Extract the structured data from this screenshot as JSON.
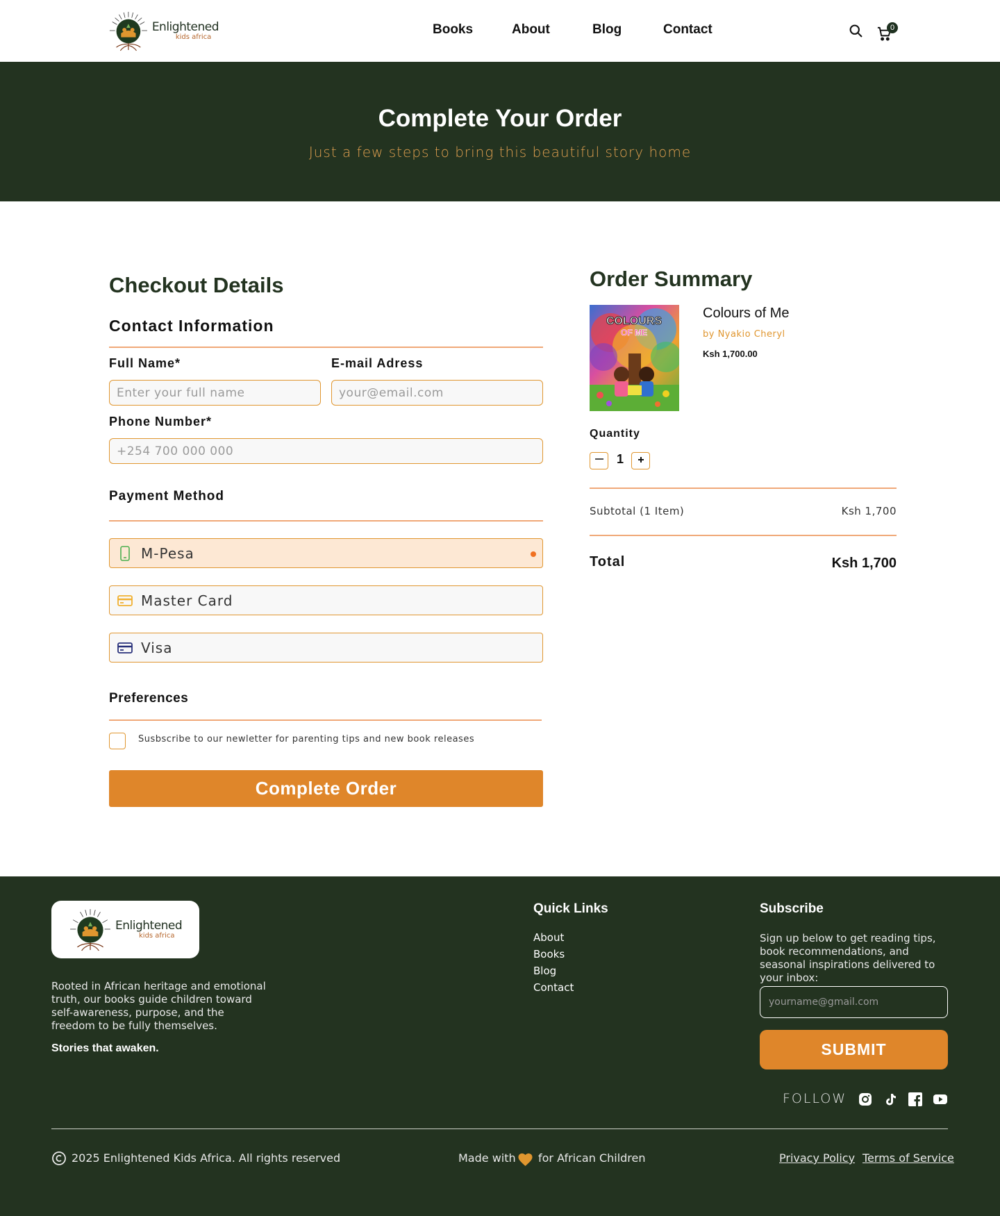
{
  "header": {
    "logo": {
      "line1": "Enlightened",
      "line2": "kids africa"
    },
    "nav": [
      "Books",
      "About",
      "Blog",
      "Contact"
    ],
    "cart_count": "0"
  },
  "hero": {
    "title": "Complete Your Order",
    "subtitle": "Just a few steps to bring this beautiful story home"
  },
  "checkout": {
    "title": "Checkout Details",
    "contact_heading": "Contact Information",
    "full_name_label": "Full Name*",
    "full_name_placeholder": "Enter your full name",
    "email_label": "E-mail Adress",
    "email_placeholder": "your@email.com",
    "phone_label": "Phone Number*",
    "phone_placeholder": "+254 700 000 000",
    "payment_heading": "Payment Method",
    "payment_options": [
      {
        "label": "M-Pesa",
        "icon": "phone-icon",
        "selected": true
      },
      {
        "label": "Master Card",
        "icon": "credit-card-icon",
        "selected": false
      },
      {
        "label": "Visa",
        "icon": "credit-card-icon",
        "selected": false
      }
    ],
    "preferences_heading": "Preferences",
    "newsletter_label": "Susbscribe to our newletter for parenting tips and new book releases",
    "submit_label": "Complete Order"
  },
  "summary": {
    "title": "Order Summary",
    "product": {
      "title": "Colours of Me",
      "author": "by Nyakio Cheryl",
      "price": "Ksh 1,700.00",
      "cover_text": "COLOURS OF ME"
    },
    "quantity_label": "Quantity",
    "quantity": "1",
    "subtotal_label": "Subtotal (1 Item)",
    "subtotal_value": "Ksh 1,700",
    "total_label": "Total",
    "total_value": "Ksh 1,700"
  },
  "footer": {
    "about": "Rooted in African heritage and emotional truth, our books guide children toward self-awareness, purpose, and the freedom to be fully themselves.",
    "tagline": "Stories that awaken.",
    "quick_links_heading": "Quick Links",
    "quick_links": [
      "About",
      "Books",
      "Blog",
      "Contact"
    ],
    "subscribe_heading": "Subscribe",
    "subscribe_text": "Sign up below to get reading tips, book recommendations, and seasonal inspirations delivered to your inbox:",
    "email_placeholder": "yourname@gmail.com",
    "submit_label": "SUBMIT",
    "follow_label": "FOLLOW",
    "social": [
      "instagram-icon",
      "tiktok-icon",
      "facebook-icon",
      "youtube-icon"
    ],
    "copyright": "2025 Enlightened Kids Africa. All rights reserved",
    "made_with_1": "Made with",
    "made_with_2": "for African Children",
    "privacy": "Privacy Policy",
    "terms": "Terms of Service"
  },
  "colors": {
    "dark_green": "#233320",
    "accent_orange": "#df862a",
    "rule_peach": "#f0a878",
    "selected_bg": "#fde8d4"
  }
}
